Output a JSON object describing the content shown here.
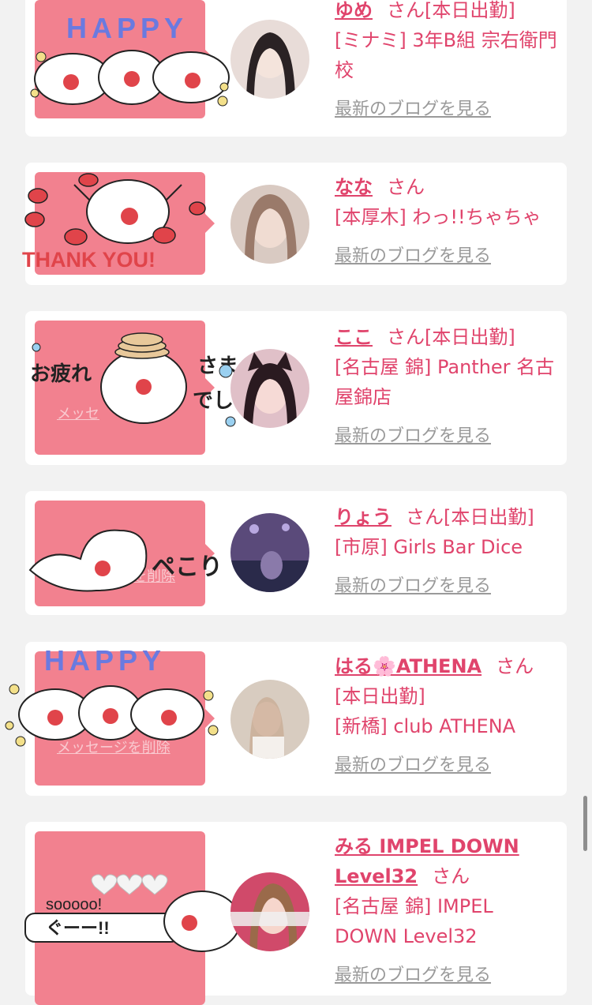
{
  "cards": [
    {
      "name": "ゆめ",
      "san": "さん",
      "status": "[本日出勤]",
      "shop": "[ミナミ] 3年B組 宗右衛門校",
      "blog": "最新のブログを見る",
      "sticker_text": "HAPPY",
      "sticker_icon": "happy-clouds-sticker",
      "delete_label": "",
      "avatar_color": "#5a4a48"
    },
    {
      "name": "なな",
      "san": "さん",
      "status": "",
      "shop": "[本厚木] わっ!!ちゃちゃ",
      "blog": "最新のブログを見る",
      "sticker_text": "THANK YOU!",
      "sticker_icon": "thank-you-cloud-sticker",
      "delete_label": "",
      "avatar_color": "#b89a8a"
    },
    {
      "name": "ここ",
      "san": "さん",
      "status": "[本日出勤]",
      "shop": "[名古屋 錦] Panther 名古屋錦店",
      "blog": "最新のブログを見る",
      "sticker_text": "お疲れさまでした",
      "sticker_icon": "otsukare-cloud-sticker",
      "delete_label": "メッセ",
      "avatar_color": "#3a2a30"
    },
    {
      "name": "りょう",
      "san": "さん",
      "status": "[本日出勤]",
      "shop": "[市原] Girls Bar Dice",
      "blog": "最新のブログを見る",
      "sticker_text": "ペこり",
      "sticker_icon": "bow-cloud-sticker",
      "delete_label": "を削除",
      "avatar_color": "#4a3a6a"
    },
    {
      "name": "はる🌸ATHENA",
      "san": "さん",
      "status": "[本日出勤]",
      "shop": "[新橋] club ATHENA",
      "blog": "最新のブログを見る",
      "sticker_text": "HAPPY",
      "sticker_icon": "happy-clouds-sticker",
      "delete_label": "メッセージを削除",
      "avatar_color": "#c8b8a8"
    },
    {
      "name": "みる IMPEL DOWN Level32",
      "san": "さん",
      "status": "",
      "shop": "[名古屋 錦] IMPEL DOWN Level32",
      "blog": "最新のブログを見る",
      "sticker_text": "sooooo!",
      "sticker_text2": "ぐーー!!",
      "sticker_icon": "good-cloud-sticker",
      "delete_label": "",
      "avatar_color": "#d04a6a"
    }
  ]
}
